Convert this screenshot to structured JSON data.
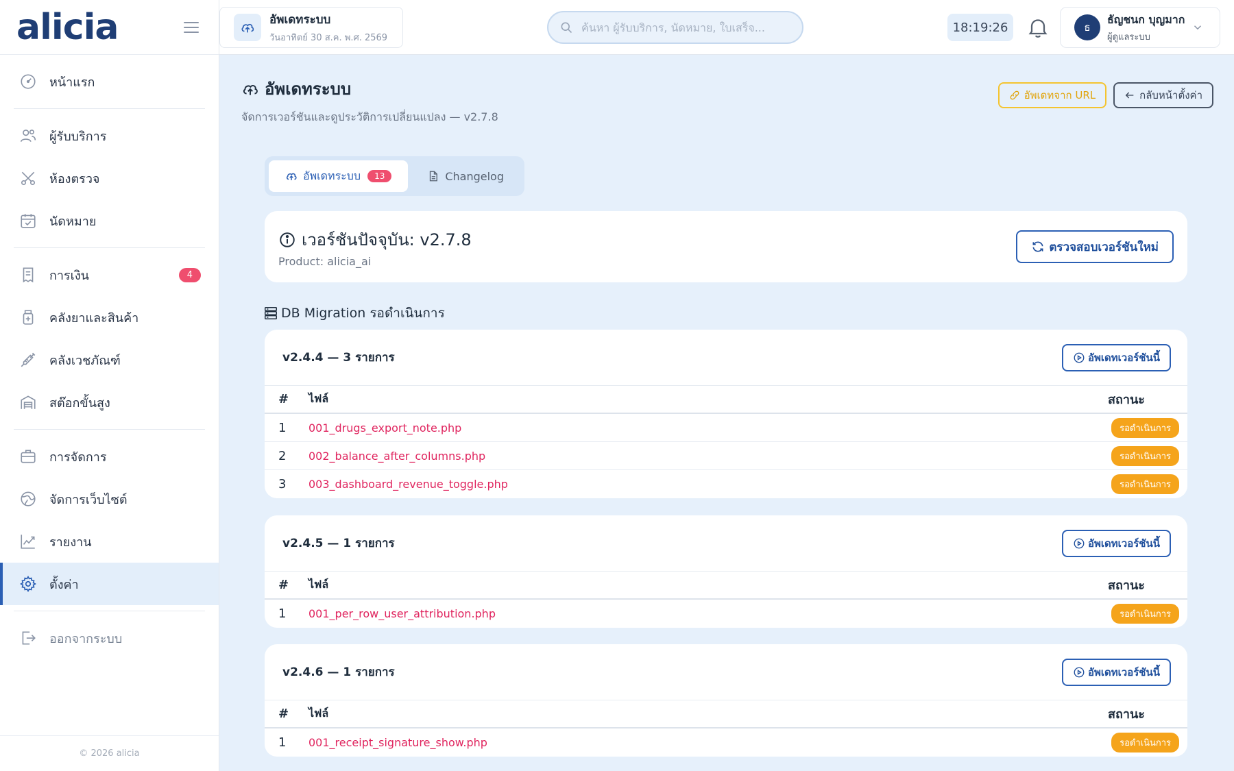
{
  "app": {
    "logo": "alicia"
  },
  "sidebar": {
    "items": [
      {
        "label": "หน้าแรก",
        "icon": "dashboard-icon"
      },
      {
        "label": "ผู้รับบริการ",
        "icon": "users-icon"
      },
      {
        "label": "ห้องตรวจ",
        "icon": "scissors-icon"
      },
      {
        "label": "นัดหมาย",
        "icon": "calendar-icon"
      },
      {
        "label": "การเงิน",
        "icon": "receipt-icon",
        "badge": "4"
      },
      {
        "label": "คลังยาและสินค้า",
        "icon": "medicine-icon"
      },
      {
        "label": "คลังเวชภัณฑ์",
        "icon": "syringe-icon"
      },
      {
        "label": "สต๊อกขั้นสูง",
        "icon": "warehouse-icon"
      },
      {
        "label": "การจัดการ",
        "icon": "briefcase-icon"
      },
      {
        "label": "จัดการเว็บไซต์",
        "icon": "globe-icon"
      },
      {
        "label": "รายงาน",
        "icon": "chart-icon"
      },
      {
        "label": "ตั้งค่า",
        "icon": "gear-icon",
        "active": true
      },
      {
        "label": "ออกจากระบบ",
        "icon": "logout-icon"
      }
    ],
    "footer": "© 2026 alicia"
  },
  "topbar": {
    "card_title": "อัพเดทระบบ",
    "card_date": "วันอาทิตย์ 30 ส.ค. พ.ศ. 2569",
    "search_placeholder": "ค้นหา ผู้รับบริการ, นัดหมาย, ใบเสร็จ...",
    "clock": "18:19:26",
    "user_initial": "ธ",
    "user_name": "ธัญชนก บุญมาก",
    "user_role": "ผู้ดูแลระบบ"
  },
  "page": {
    "title": "อัพเดทระบบ",
    "subtitle": "จัดการเวอร์ชันและดูประวัติการเปลี่ยนแปลง — v2.7.8",
    "btn_update_url": "อัพเดทจาก URL",
    "btn_back": "กลับหน้าตั้งค่า"
  },
  "tabs": [
    {
      "label": "อัพเดทระบบ",
      "badge": "13",
      "active": true
    },
    {
      "label": "Changelog"
    }
  ],
  "version": {
    "title": "เวอร์ชันปัจจุบัน: v2.7.8",
    "product": "Product: alicia_ai",
    "check_button": "ตรวจสอบเวอร์ชันใหม่"
  },
  "migrations": {
    "section_title": "DB Migration รอดำเนินการ",
    "col_num": "#",
    "col_file": "ไฟล์",
    "col_status": "สถานะ",
    "update_button": "อัพเดทเวอร์ชันนี้",
    "groups": [
      {
        "title": "v2.4.4 — 3 รายการ",
        "rows": [
          {
            "num": "1",
            "file": "001_drugs_export_note.php",
            "status": "รอดำเนินการ"
          },
          {
            "num": "2",
            "file": "002_balance_after_columns.php",
            "status": "รอดำเนินการ"
          },
          {
            "num": "3",
            "file": "003_dashboard_revenue_toggle.php",
            "status": "รอดำเนินการ"
          }
        ]
      },
      {
        "title": "v2.4.5 — 1 รายการ",
        "rows": [
          {
            "num": "1",
            "file": "001_per_row_user_attribution.php",
            "status": "รอดำเนินการ"
          }
        ]
      },
      {
        "title": "v2.4.6 — 1 รายการ",
        "rows": [
          {
            "num": "1",
            "file": "001_receipt_signature_show.php",
            "status": "รอดำเนินการ"
          }
        ]
      }
    ]
  },
  "colors": {
    "brand": "#1f3e75",
    "accent": "#2b5fb4",
    "badge": "#ef4e6e",
    "pending": "#f5a41b",
    "file_link": "#e0245e"
  }
}
